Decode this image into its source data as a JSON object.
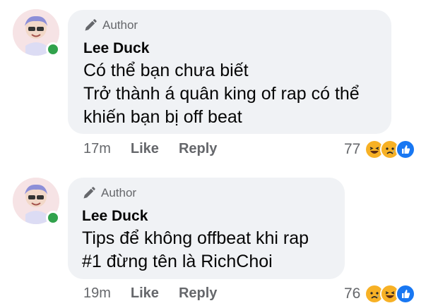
{
  "comments": [
    {
      "badge": "Author",
      "name": "Lee Duck",
      "lines": [
        "Có thể bạn chưa biết",
        "Trở thành á quân king of rap có thể",
        "khiến bạn bị off beat"
      ],
      "time": "17m",
      "like_label": "Like",
      "reply_label": "Reply",
      "reaction_count": "77",
      "reactions": [
        "haha-icon",
        "sad-icon",
        "like-icon"
      ]
    },
    {
      "badge": "Author",
      "name": "Lee Duck",
      "lines": [
        "Tips để không offbeat khi rap",
        "#1 đừng tên là RichChoi"
      ],
      "time": "19m",
      "like_label": "Like",
      "reply_label": "Reply",
      "reaction_count": "76",
      "reactions": [
        "sad-icon",
        "haha-icon",
        "like-icon"
      ]
    }
  ],
  "colors": {
    "bubble": "#f0f2f5",
    "online": "#31a24c",
    "muted": "#65676b",
    "like_blue": "#1877f2"
  }
}
